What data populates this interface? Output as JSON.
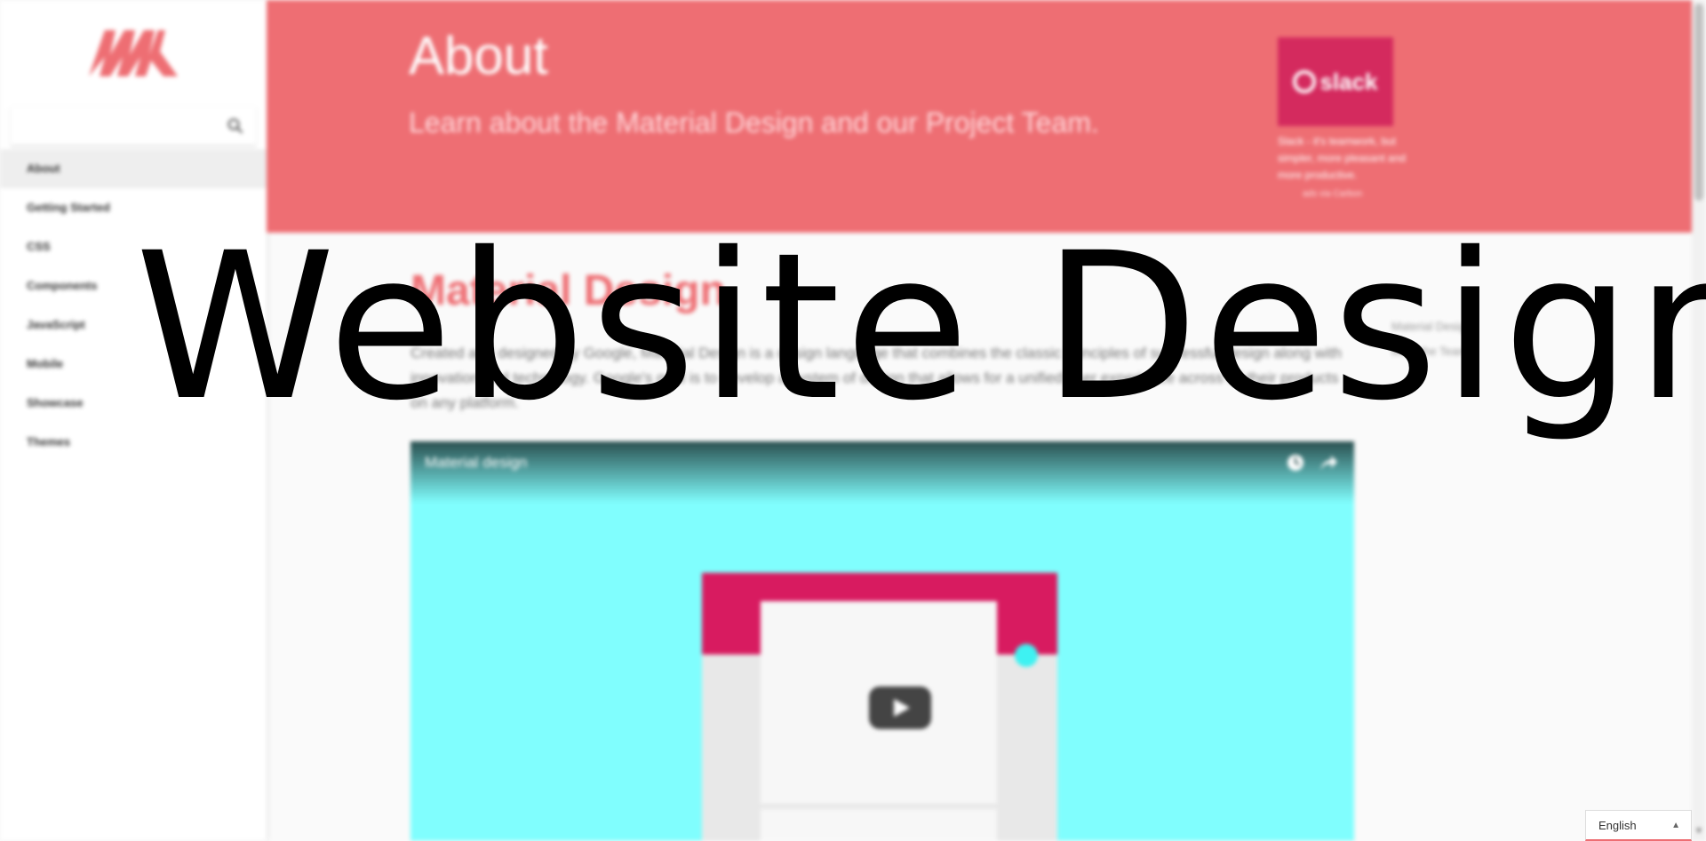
{
  "sidebar": {
    "search_placeholder": "",
    "items": [
      {
        "label": "About"
      },
      {
        "label": "Getting Started"
      },
      {
        "label": "CSS"
      },
      {
        "label": "Components"
      },
      {
        "label": "JavaScript"
      },
      {
        "label": "Mobile"
      },
      {
        "label": "Showcase"
      },
      {
        "label": "Themes"
      }
    ]
  },
  "header": {
    "title": "About",
    "subtitle": "Learn about the Material Design and our Project Team."
  },
  "ad": {
    "brand": "slack",
    "text": "Slack - it's teamwork, but simpler, more pleasant and more productive.",
    "via": "ads via Carbon"
  },
  "content": {
    "title": "Material Design",
    "paragraph": "Created and designed by Google, Material Design is a design language that combines the classic principles of successful design along with innovation and technology. Google's goal is to develop a system of design that allows for a unified user experience across all their products on any platform.",
    "toc": [
      "Material Design",
      "Meet the Team"
    ]
  },
  "video": {
    "title": "Material design"
  },
  "overlay": {
    "title": "Website Design"
  },
  "language": {
    "selected": "English"
  },
  "colors": {
    "accent": "#ee6e73",
    "video_bg": "#80fefe",
    "device_bar": "#d81b60",
    "ad_bg": "#d42a5e"
  }
}
